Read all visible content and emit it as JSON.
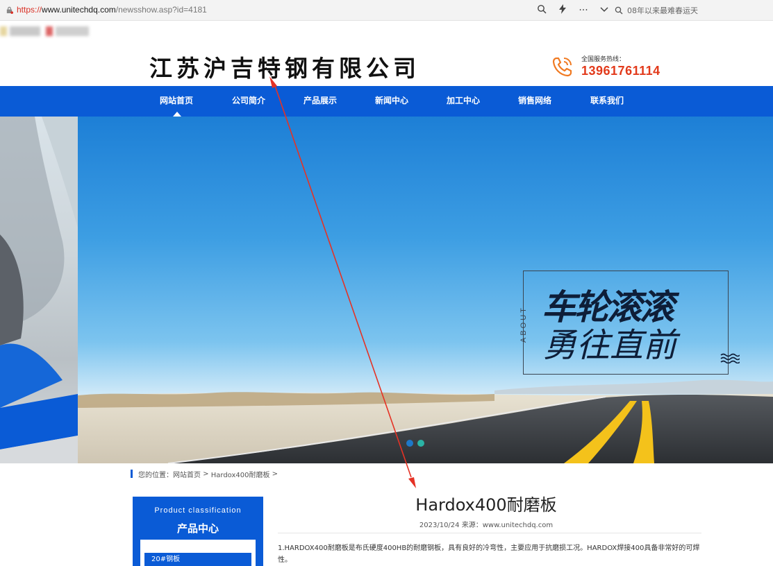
{
  "browser": {
    "url_scheme": "https://",
    "url_host": "www.unitechdq.com",
    "url_path": "/newsshow.asp?id=4181",
    "search_text": "08年以来最难春运天",
    "icons": [
      "lock-icon",
      "zoom-icon",
      "lightning-icon",
      "more-icon",
      "chevron-down-icon",
      "search-icon"
    ]
  },
  "header": {
    "site_title": "江苏沪吉特钢有限公司",
    "hotline_label": "全国服务热线：",
    "hotline_number": "13961761114"
  },
  "nav": {
    "items": [
      {
        "label": "网站首页"
      },
      {
        "label": "公司简介"
      },
      {
        "label": "产品展示"
      },
      {
        "label": "新闻中心"
      },
      {
        "label": "加工中心"
      },
      {
        "label": "销售网络"
      },
      {
        "label": "联系我们"
      }
    ],
    "color": "#0a5bd6"
  },
  "banner": {
    "about_text": "ABOUT",
    "slogan_line1": "车轮滚滚",
    "slogan_line2": "勇往直前",
    "slide_count": 2
  },
  "breadcrumb": {
    "prefix": "您的位置：",
    "home": "网站首页",
    "separator1": " > ",
    "current": "Hardox400耐磨板",
    "separator2": " >"
  },
  "sidebar": {
    "title_en": "Product classification",
    "title_cn": "产品中心",
    "items": [
      {
        "label": "20#钢板"
      }
    ]
  },
  "article": {
    "title": "Hardox400耐磨板",
    "meta": "2023/10/24 来源：www.unitechdq.com",
    "body_line1": "1.HARDOX400耐磨板是布氏硬度400HB的耐磨钢板，具有良好的冷弯性，主要应用于抗磨损工况。HARDOX焊接400具备非常好的可焊",
    "body_line2": "性。"
  },
  "colors": {
    "brand_blue": "#0a5bd6",
    "hotline_red": "#e23a1b",
    "annotation_red": "#e53225",
    "dot_active": "#2bb3a5",
    "dot_inactive": "#1e78c8"
  }
}
